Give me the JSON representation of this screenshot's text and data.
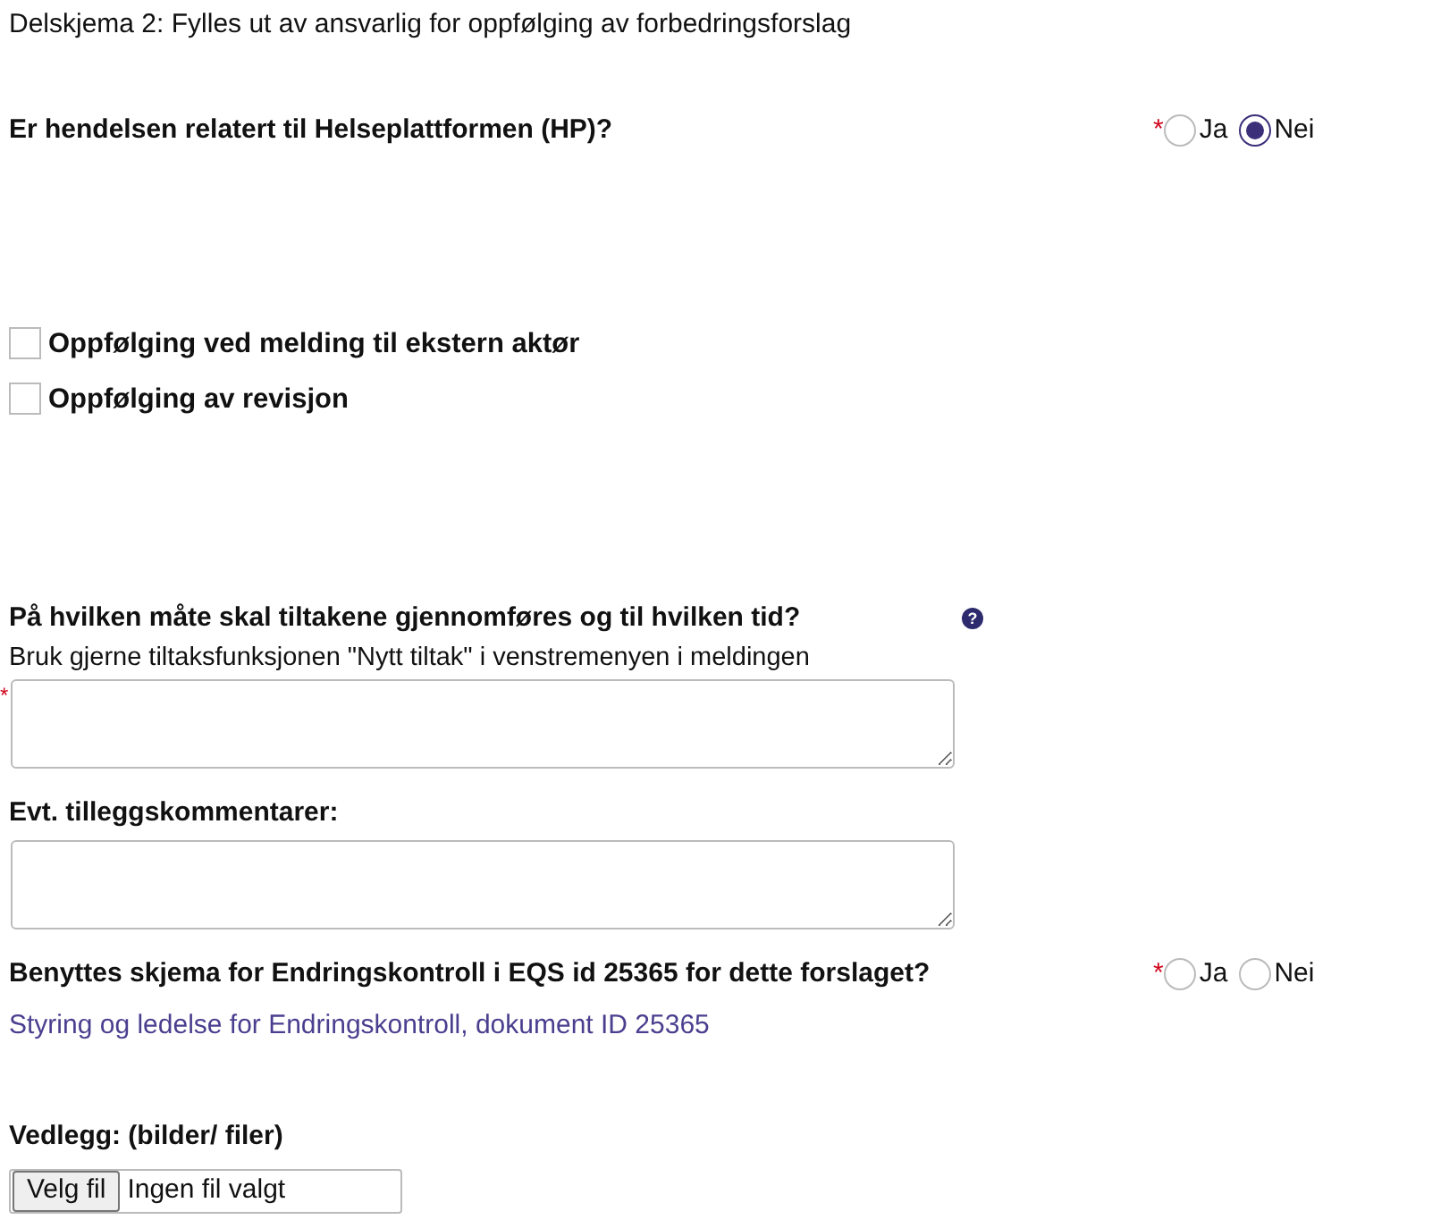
{
  "form_title": "Delskjema 2: Fylles ut av ansvarlig for oppfølging av forbedringsforslag",
  "question_hp": {
    "label": "Er hendelsen relatert til Helseplattformen (HP)?",
    "required_mark": "*",
    "options": [
      {
        "label": "Ja",
        "selected": false
      },
      {
        "label": "Nei",
        "selected": true
      }
    ]
  },
  "checkboxes": [
    {
      "label": "Oppfølging ved melding til ekstern aktør",
      "checked": false
    },
    {
      "label": "Oppfølging av revisjon",
      "checked": false
    }
  ],
  "measures": {
    "label": "På hvilken måte skal tiltakene gjennomføres og til hvilken tid?",
    "help_icon": "?",
    "hint": "Bruk gjerne tiltaksfunksjonen \"Nytt tiltak\" i venstremenyen i meldingen",
    "required_mark": "*"
  },
  "comments": {
    "label": "Evt. tilleggskommentarer:"
  },
  "question_eqs": {
    "label": "Benyttes skjema for Endringskontroll i EQS id 25365 for dette forslaget?",
    "required_mark": "*",
    "options": [
      {
        "label": "Ja",
        "selected": false
      },
      {
        "label": "Nei",
        "selected": false
      }
    ],
    "link": "Styring og ledelse for Endringskontroll, dokument ID 25365"
  },
  "attachments": {
    "label": "Vedlegg: (bilder/ filer)",
    "button": "Velg fil",
    "status": "Ingen fil valgt"
  }
}
